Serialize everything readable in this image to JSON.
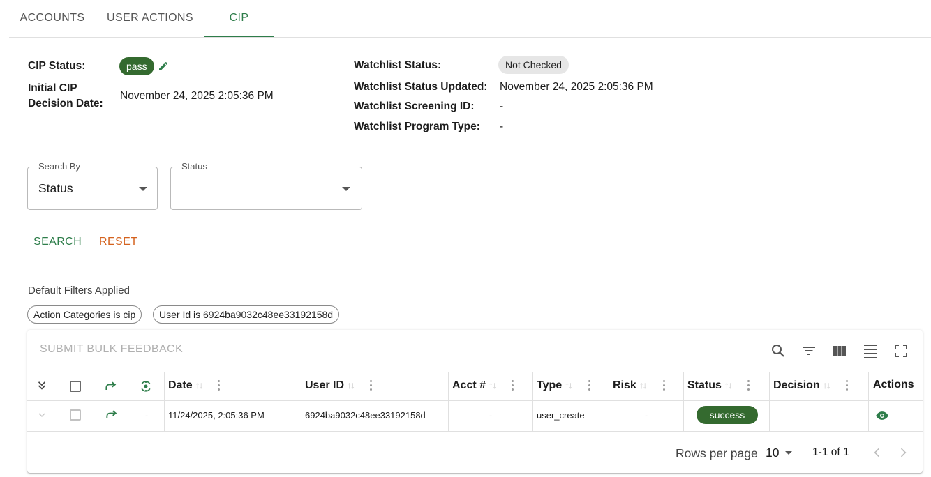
{
  "tabs": [
    {
      "label": "ACCOUNTS"
    },
    {
      "label": "USER ACTIONS"
    },
    {
      "label": "CIP"
    }
  ],
  "cip": {
    "status_label": "CIP Status:",
    "status_value": "pass",
    "initial_label_line1": "Initial CIP",
    "initial_label_line2": "Decision Date:",
    "initial_value": "November 24, 2025 2:05:36 PM"
  },
  "watchlist": {
    "status_label": "Watchlist Status:",
    "status_value": "Not Checked",
    "updated_label": "Watchlist Status Updated:",
    "updated_value": "November 24, 2025 2:05:36 PM",
    "screening_label": "Watchlist Screening ID:",
    "screening_value": "-",
    "program_label": "Watchlist Program Type:",
    "program_value": "-"
  },
  "search_form": {
    "search_by_label": "Search By",
    "search_by_value": "Status",
    "status_label": "Status",
    "status_value": "",
    "search_button": "SEARCH",
    "reset_button": "RESET"
  },
  "filters": {
    "heading": "Default Filters Applied",
    "chips": [
      {
        "label": "Action Categories is cip"
      },
      {
        "label": "User Id is 6924ba9032c48ee33192158d"
      }
    ]
  },
  "table": {
    "bulk_button": "SUBMIT BULK FEEDBACK",
    "toolbar_icons": [
      "search-icon",
      "filter-icon",
      "columns-icon",
      "density-icon",
      "fullscreen-icon"
    ],
    "columns": [
      {
        "label": "Date"
      },
      {
        "label": "User ID"
      },
      {
        "label": "Acct #"
      },
      {
        "label": "Type"
      },
      {
        "label": "Risk"
      },
      {
        "label": "Status"
      },
      {
        "label": "Decision"
      },
      {
        "label": "Actions"
      }
    ],
    "rows": [
      {
        "expand_icon": "chevron-down-icon",
        "action_icon": "forward-icon",
        "pin": "-",
        "date": "11/24/2025, 2:05:36 PM",
        "user_id": "6924ba9032c48ee33192158d",
        "acct": "-",
        "type": "user_create",
        "risk": "-",
        "status": "success",
        "decision": "",
        "action": "eye-icon"
      }
    ],
    "footer": {
      "rows_per_page_label": "Rows per page",
      "rows_per_page_value": "10",
      "range": "1-1 of 1"
    }
  },
  "colors": {
    "accent": "#2e7d4a",
    "reset": "#d4621e",
    "pill": "#346a2f"
  }
}
